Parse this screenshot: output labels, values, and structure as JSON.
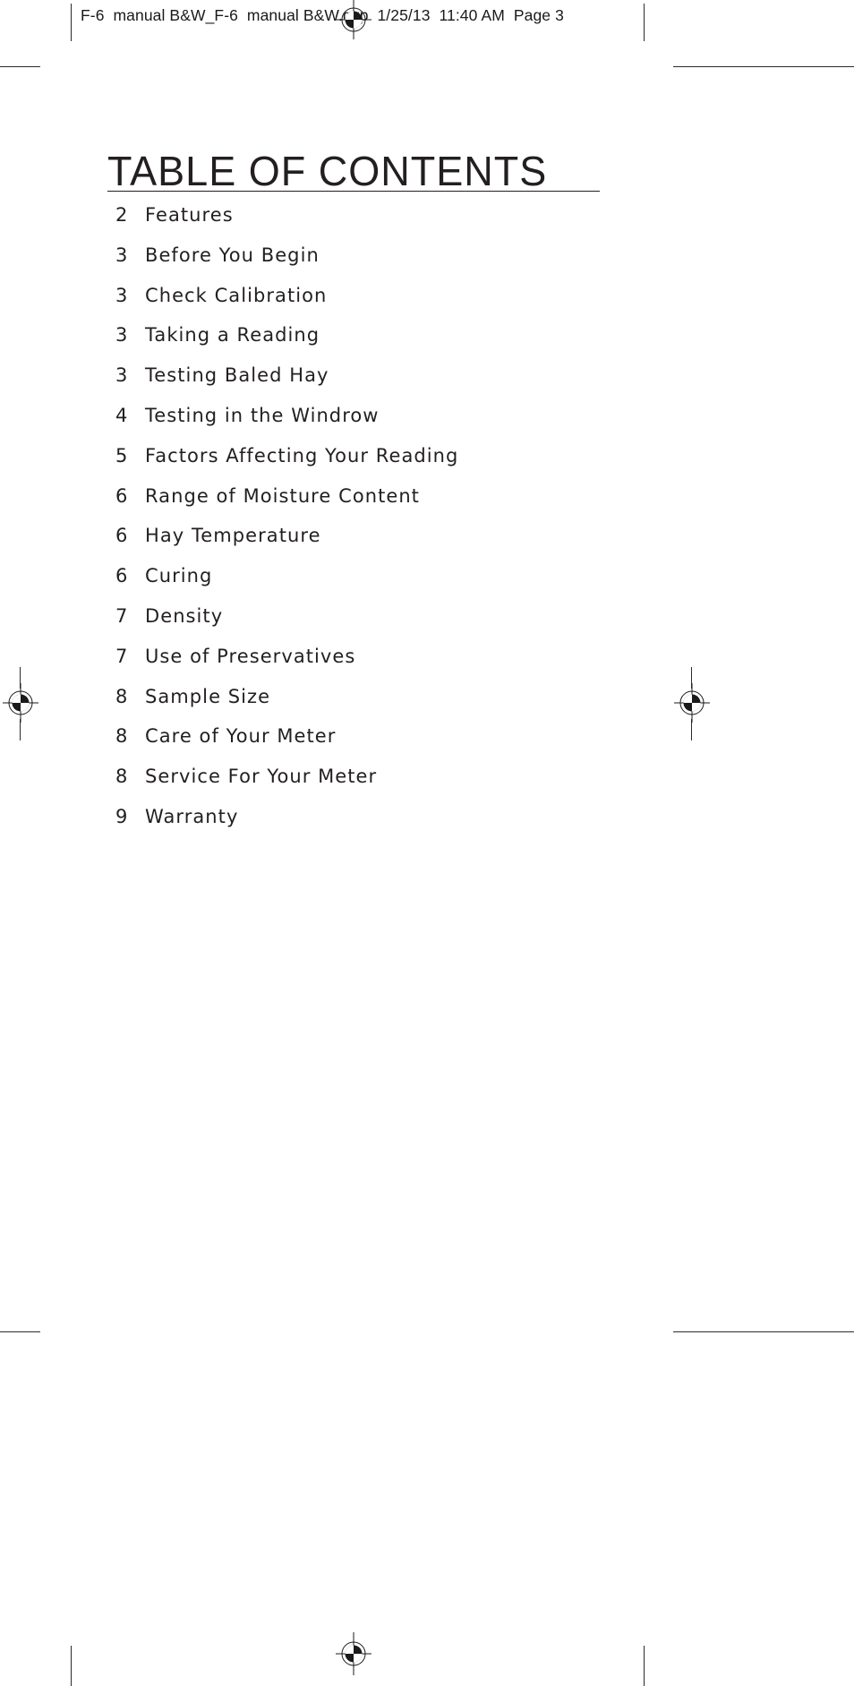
{
  "prepress": {
    "slug": "F-6  manual B&W_F-6  manual B&W.qxp  1/25/13  11:40 AM  Page 3",
    "registration_icon": "registration-target-icon",
    "crop_mark_icon": "crop-mark-icon",
    "ink_color": "#231f20"
  },
  "document": {
    "title": "TABLE OF CONTENTS",
    "entries": [
      {
        "page": "2",
        "label": "Features"
      },
      {
        "page": "3",
        "label": "Before You Begin"
      },
      {
        "page": "3",
        "label": "Check Calibration"
      },
      {
        "page": "3",
        "label": "Taking a Reading"
      },
      {
        "page": "3",
        "label": "Testing Baled Hay"
      },
      {
        "page": "4",
        "label": "Testing in the Windrow"
      },
      {
        "page": "5",
        "label": "Factors Affecting Your Reading"
      },
      {
        "page": "6",
        "label": "Range of Moisture Content"
      },
      {
        "page": "6",
        "label": "Hay Temperature"
      },
      {
        "page": "6",
        "label": "Curing"
      },
      {
        "page": "7",
        "label": "Density"
      },
      {
        "page": "7",
        "label": "Use of Preservatives"
      },
      {
        "page": "8",
        "label": "Sample Size"
      },
      {
        "page": "8",
        "label": "Care of Your Meter"
      },
      {
        "page": "8",
        "label": "Service For Your Meter"
      },
      {
        "page": "9",
        "label": "Warranty"
      }
    ]
  }
}
